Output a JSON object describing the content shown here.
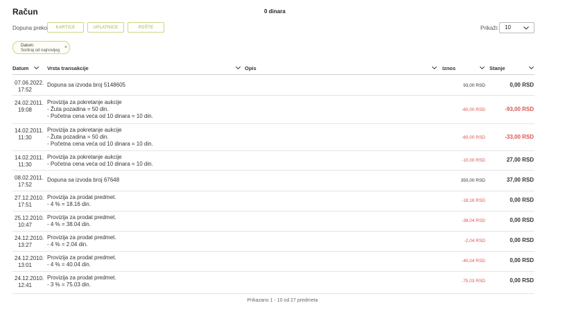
{
  "header": {
    "title": "Račun",
    "balance": "0 dinara"
  },
  "topup": {
    "label": "Dopuna preko:",
    "buttons": [
      "KARTICE",
      "UPLATNICE",
      "POŠTE"
    ]
  },
  "display": {
    "label": "Prikaži:",
    "value": "10"
  },
  "filter_chip": {
    "line1": "Datum:",
    "line2": "Sortiraj od najnovijeg",
    "close": "×"
  },
  "columns": [
    "Datum",
    "Vrsta transakcije",
    "Opis",
    "Iznos",
    "Stanje"
  ],
  "rows": [
    {
      "date": "07.06.2022.",
      "time": "17:52",
      "lines": [
        "Dopuna sa izvoda broj 5148605"
      ],
      "amount": "93,00 RSD",
      "balance": "0,00 RSD",
      "amount_neg": false,
      "balance_neg": false
    },
    {
      "date": "24.02.2011.",
      "time": "19:08",
      "lines": [
        "Provizija za pokretanje aukcije",
        "- Žuta pozadina = 50 din.",
        "- Početna cena veća od 10 dinara = 10 din."
      ],
      "amount": "-60,00 RSD",
      "balance": "-93,00 RSD",
      "amount_neg": true,
      "balance_neg": true
    },
    {
      "date": "14.02.2011.",
      "time": "11:30",
      "lines": [
        "Provizija za pokretanje aukcije",
        "- Žuta pozadina = 50 din.",
        "- Početna cena veća od 10 dinara = 10 din."
      ],
      "amount": "-60,00 RSD",
      "balance": "-33,00 RSD",
      "amount_neg": true,
      "balance_neg": true
    },
    {
      "date": "14.02.2011.",
      "time": "11:30",
      "lines": [
        "Provizija za pokretanje aukcije",
        "- Početna cena veća od 10 dinara = 10 din."
      ],
      "amount": "-10,00 RSD",
      "balance": "27,00 RSD",
      "amount_neg": true,
      "balance_neg": false
    },
    {
      "date": "08.02.2011.",
      "time": "17:52",
      "lines": [
        "Dopuna sa izvoda broj 67648"
      ],
      "amount": "350,00 RSD",
      "balance": "37,00 RSD",
      "amount_neg": false,
      "balance_neg": false
    },
    {
      "date": "27.12.2010.",
      "time": "17:51",
      "lines": [
        "Provizija za prodat predmet.",
        "- 4 % = 18.16 din."
      ],
      "amount": "-18,16 RSD",
      "balance": "0,00 RSD",
      "amount_neg": true,
      "balance_neg": false
    },
    {
      "date": "25.12.2010.",
      "time": "10:47",
      "lines": [
        "Provizija za prodat predmet.",
        "- 4 % = 38.04 din."
      ],
      "amount": "-38,04 RSD",
      "balance": "0,00 RSD",
      "amount_neg": true,
      "balance_neg": false
    },
    {
      "date": "24.12.2010.",
      "time": "13:27",
      "lines": [
        "Provizija za prodat predmet.",
        "- 4 % = 2.04 din."
      ],
      "amount": "-2,04 RSD",
      "balance": "0,00 RSD",
      "amount_neg": true,
      "balance_neg": false
    },
    {
      "date": "24.12.2010.",
      "time": "13:01",
      "lines": [
        "Provizija za prodat predmet.",
        "- 4 % = 40.04 din."
      ],
      "amount": "-40,04 RSD",
      "balance": "0,00 RSD",
      "amount_neg": true,
      "balance_neg": false
    },
    {
      "date": "24.12.2010.",
      "time": "12:41",
      "lines": [
        "Provizija za prodat predmet.",
        "- 3 % = 75.03 din."
      ],
      "amount": "-75,03 RSD",
      "balance": "0,00 RSD",
      "amount_neg": true,
      "balance_neg": false
    }
  ],
  "footer": {
    "text": "Prikazano 1 - 10 od 27 predmeta"
  },
  "colors": {
    "accent": "#c6d97f",
    "accent_text": "#9db04a",
    "negative": "#d9534f"
  }
}
